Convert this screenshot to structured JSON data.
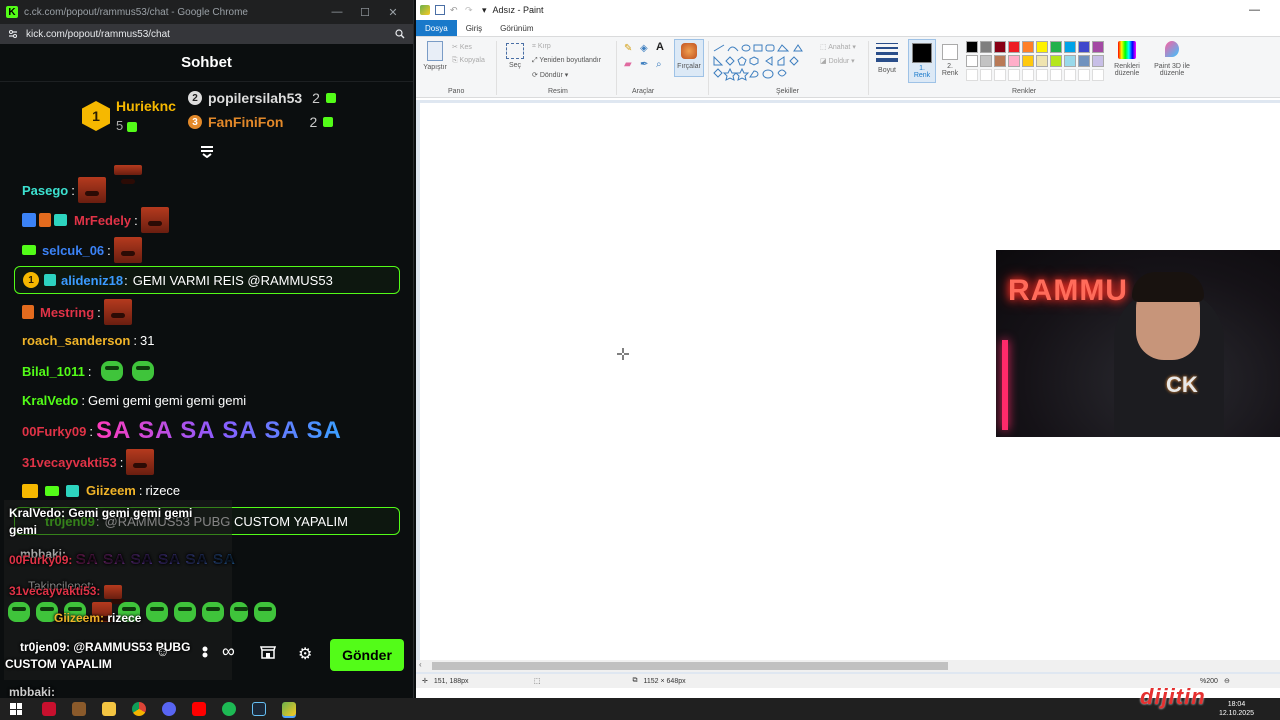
{
  "chrome": {
    "window_title": "c.ck.com/popout/rammus53/chat - Google Chrome",
    "url": "kick.com/popout/rammus53/chat",
    "controls": {
      "minimize": "—",
      "maximize": "☐",
      "close": "✕"
    }
  },
  "chat": {
    "header": "Sohbet",
    "leaderboard": [
      {
        "rank": "1",
        "name": "Hurieknc",
        "count": "5"
      },
      {
        "rank": "2",
        "name": "popilersilah53",
        "count": "2"
      },
      {
        "rank": "3",
        "name": "FanFiniFon",
        "count": "2"
      }
    ],
    "messages": [
      {
        "user": "Pasego",
        "text": "",
        "color": "#3ce1d0"
      },
      {
        "user": "MrFedely",
        "text": "",
        "color": "#e03347"
      },
      {
        "user": "selcuk_06",
        "text": "",
        "color": "#3b82f6"
      },
      {
        "user": "alideniz18",
        "text": "GEMI VARMI REIS @RAMMUS53",
        "color": "#3b9bff"
      },
      {
        "user": "Mestring",
        "text": "",
        "color": "#e03347"
      },
      {
        "user": "roach_sanderson",
        "text": "31",
        "color": "#f0b429"
      },
      {
        "user": "Bilal_1011",
        "text": "",
        "color": "#53fc18"
      },
      {
        "user": "KralVedo",
        "text": "Gemi gemi gemi gemi gemi",
        "color": "#53fc18"
      },
      {
        "user": "00Furky09",
        "text": "SA SA SA SA SA SA",
        "color": "#e03347"
      },
      {
        "user": "31vecayvakti53",
        "text": "",
        "color": "#e03347"
      },
      {
        "user": "Giizeem",
        "text": "rizece",
        "color": "#f0b429"
      },
      {
        "user": "tr0jen09",
        "text": "@RAMMUS53 PUBG CUSTOM YAPALIM",
        "color": "#53fc18"
      }
    ],
    "overlay": {
      "line1": "KralVedo: Gemi gemi gemi gemi",
      "line1b": "gemi",
      "line2_user": "mbbaki:",
      "line2_sasa": "SA SA SA SA SA SA",
      "line2_user2": "00Furky09:",
      "line3": "Takipcilenot:",
      "line3b": "31vecayvakti53:",
      "line4_user": "Giizeem:",
      "line4_text": "rizece",
      "line5": "tr0jen09: @RAMMUS53 PUBG",
      "line5b": "CUSTOM YAPALIM",
      "line6": "mbbaki:"
    },
    "send_label": "Gönder"
  },
  "paint": {
    "title": "Adsız - Paint",
    "tabs": [
      "Dosya",
      "Giriş",
      "Görünüm"
    ],
    "ribbon": {
      "paste": "Yapıştır",
      "cut": "Kes",
      "copy": "Kopyala",
      "select": "Seç",
      "crop": "Kırp",
      "resize": "Yeniden boyutlandır",
      "rotate": "Döndür",
      "brushes": "Fırçalar",
      "outline": "Anahat",
      "fill": "Doldur",
      "size": "Boyut",
      "color1": "1.\nRenk",
      "color1_a": "1.",
      "color1_b": "Renk",
      "color2_a": "2.",
      "color2_b": "Renk",
      "edit_colors_a": "Renkleri",
      "edit_colors_b": "düzenle",
      "paint3d_a": "Paint 3D ile",
      "paint3d_b": "düzenle",
      "groups": [
        "Pano",
        "Resim",
        "Araçlar",
        "Şekiller",
        "Renkler"
      ]
    },
    "status": {
      "cursor_pos": "151, 188px",
      "image_size": "1152 × 648px",
      "zoom": "%200"
    }
  },
  "taskbar": {
    "time": "18:04",
    "date": "12.10.2025"
  },
  "colors": {
    "kick_green": "#53fc18",
    "chat_bg": "#0b0e0f",
    "paint_blue": "#1979ca"
  }
}
